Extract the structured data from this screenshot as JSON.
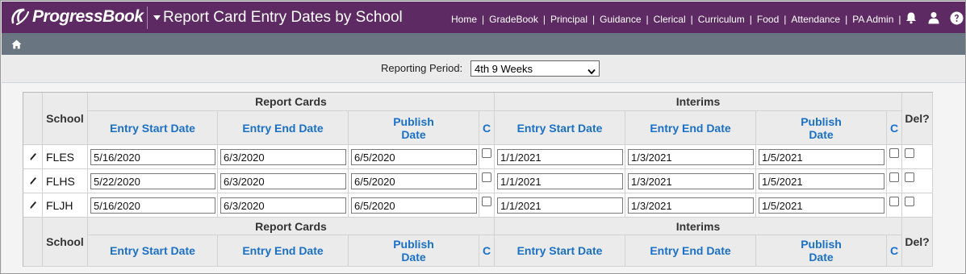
{
  "header": {
    "brand": "ProgressBook",
    "app_title": "Report Card Entry Dates by School",
    "nav": [
      "Home",
      "GradeBook",
      "Principal",
      "Guidance",
      "Clerical",
      "Curriculum",
      "Food",
      "Attendance",
      "PA Admin"
    ],
    "nav_separator": "|",
    "icons": [
      "bell-icon",
      "user-icon",
      "help-icon"
    ],
    "bg_color": "#5e2a63"
  },
  "breadcrumb": {
    "icon": "home-icon",
    "bg_color": "#697580"
  },
  "period": {
    "label": "Reporting Period:",
    "selected": "4th 9 Weeks"
  },
  "table": {
    "groups": {
      "report_cards": "Report Cards",
      "interims": "Interims"
    },
    "columns": {
      "school": "School",
      "entry_start": "Entry Start Date",
      "entry_end": "Entry End Date",
      "publish_line1": "Publish",
      "publish_line2": "Date",
      "c": "C",
      "del": "Del?"
    },
    "rows": [
      {
        "school": "FLES",
        "rc_start": "5/16/2020",
        "rc_end": "6/3/2020",
        "rc_publish": "6/5/2020",
        "int_start": "1/1/2021",
        "int_end": "1/3/2021",
        "int_publish": "1/5/2021"
      },
      {
        "school": "FLHS",
        "rc_start": "5/22/2020",
        "rc_end": "6/3/2020",
        "rc_publish": "6/5/2020",
        "int_start": "1/1/2021",
        "int_end": "1/3/2021",
        "int_publish": "1/5/2021"
      },
      {
        "school": "FLJH",
        "rc_start": "5/16/2020",
        "rc_end": "6/3/2020",
        "rc_publish": "6/5/2020",
        "int_start": "1/1/2021",
        "int_end": "1/3/2021",
        "int_publish": "1/5/2021"
      }
    ],
    "link_color": "#1a70c8"
  }
}
